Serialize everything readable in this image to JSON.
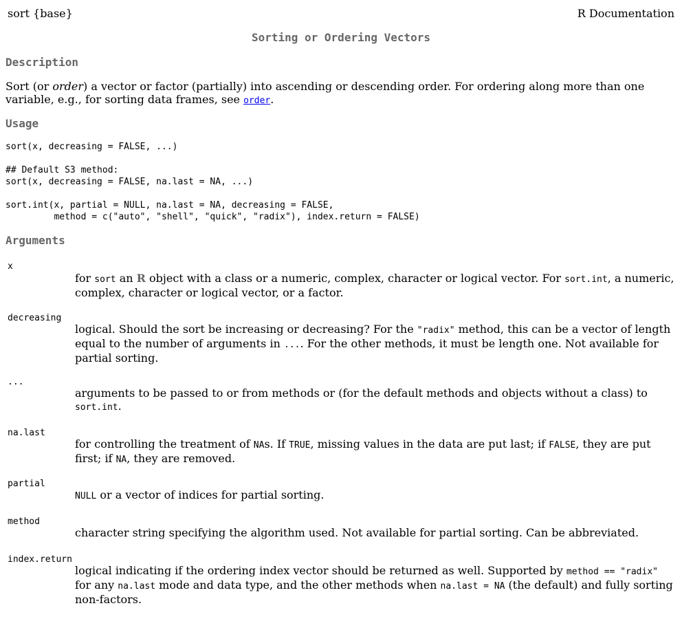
{
  "header": {
    "topic": "sort {base}",
    "source": "R Documentation"
  },
  "title": "Sorting or Ordering Vectors",
  "description": {
    "heading": "Description",
    "t1": "Sort (or ",
    "t2": "order",
    "t3": ") a vector or factor (partially) into ascending or descending order. For ordering along more than one variable, e.g., for sorting data frames, see ",
    "link": "order",
    "t4": "."
  },
  "usage": {
    "heading": "Usage",
    "lines": [
      "sort(x, decreasing = FALSE, ...)",
      "## Default S3 method:",
      "sort(x, decreasing = FALSE, na.last = NA, ...)",
      "sort.int(x, partial = NULL, na.last = NA, decreasing = FALSE,",
      "         method = c(\"auto\", \"shell\", \"quick\", \"radix\"), index.return = FALSE)"
    ]
  },
  "arguments": {
    "heading": "Arguments",
    "x": {
      "name": "x",
      "t1": "for ",
      "c1": "sort",
      "t2": " an ",
      "logo": "R",
      "t3": " object with a class or a numeric, complex, character or logical vector. For ",
      "c2": "sort.int",
      "t4": ", a numeric, complex, character or logical vector, or a factor."
    },
    "decreasing": {
      "name": "decreasing",
      "t1": "logical. Should the sort be increasing or decreasing? For the ",
      "c1": "\"radix\"",
      "t2": " method, this can be a vector of length equal to the number of arguments in ",
      "c2": "...",
      "t3": ". For the other methods, it must be length one. Not available for partial sorting."
    },
    "dots": {
      "name": "...",
      "t1": "arguments to be passed to or from methods or (for the default methods and objects without a class) to ",
      "c1": "sort.int",
      "t2": "."
    },
    "na_last": {
      "name": "na.last",
      "t1": "for controlling the treatment of ",
      "c1": "NA",
      "t2": "s. If ",
      "c2": "TRUE",
      "t3": ", missing values in the data are put last; if ",
      "c3": "FALSE",
      "t4": ", they are put first; if ",
      "c4": "NA",
      "t5": ", they are removed."
    },
    "partial": {
      "name": "partial",
      "c1": "NULL",
      "t1": " or a vector of indices for partial sorting."
    },
    "method": {
      "name": "method",
      "t1": "character string specifying the algorithm used. Not available for partial sorting. Can be abbreviated."
    },
    "index_return": {
      "name": "index.return",
      "t1": "logical indicating if the ordering index vector should be returned as well. Supported by ",
      "c1": "method == \"radix\"",
      "t2": " for any ",
      "c2": "na.last",
      "t3": " mode and data type, and the other methods when ",
      "c3": "na.last = NA",
      "t4": " (the default) and fully sorting non-factors."
    }
  }
}
